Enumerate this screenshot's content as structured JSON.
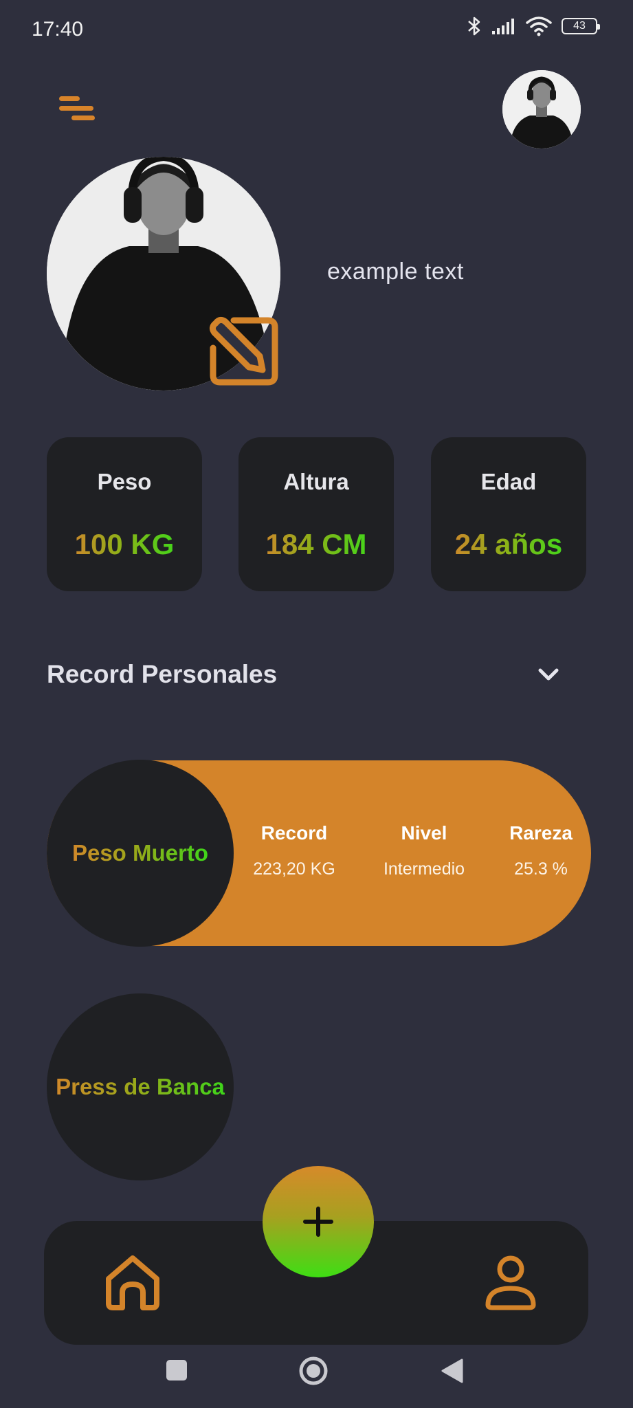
{
  "status_bar": {
    "time": "17:40",
    "battery": "43"
  },
  "profile": {
    "name": "example text"
  },
  "stats": [
    {
      "label": "Peso",
      "value": "100 KG"
    },
    {
      "label": "Altura",
      "value": "184 CM"
    },
    {
      "label": "Edad",
      "value": "24 años"
    }
  ],
  "records_section": {
    "title": "Record Personales"
  },
  "records": [
    {
      "exercise": "Peso Muerto",
      "columns": [
        {
          "label": "Record",
          "value": "223,20 KG"
        },
        {
          "label": "Nivel",
          "value": "Intermedio"
        },
        {
          "label": "Rareza",
          "value": "25.3 %"
        }
      ]
    },
    {
      "exercise": "Press de Banca"
    }
  ],
  "colors": {
    "background": "#2e2f3d",
    "card": "#1f2023",
    "accent_orange": "#d4842a",
    "accent_green": "#3ed51a"
  }
}
